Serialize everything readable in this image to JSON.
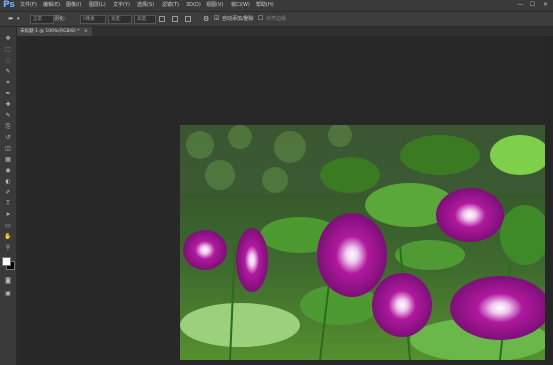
{
  "app": {
    "logo": "Ps"
  },
  "menu": [
    "文件(F)",
    "编辑(E)",
    "图像(I)",
    "图层(L)",
    "文字(Y)",
    "选择(S)",
    "滤镜(T)",
    "3D(D)",
    "视图(V)",
    "窗口(W)",
    "帮助(H)"
  ],
  "window_controls": {
    "minimize": "—",
    "maximize": "☐",
    "close": "✕"
  },
  "options": {
    "feather_label": "羽化:",
    "feather_value": "0像素",
    "style_label": "样式:",
    "style_value": "正常",
    "width_label": "宽度:",
    "height_label": "高度:",
    "auto_add_delete": "自动添加/删除",
    "align_edges": "对齐边缘"
  },
  "document": {
    "tab_title": "未标题-1 @ 100%(RGB/8) *",
    "close": "×"
  },
  "toolbar": {
    "tools": [
      "move-tool",
      "marquee-tool",
      "lasso-tool",
      "quick-select-tool",
      "crop-tool",
      "eyedropper-tool",
      "healing-tool",
      "brush-tool",
      "stamp-tool",
      "history-brush-tool",
      "eraser-tool",
      "gradient-tool",
      "blur-tool",
      "dodge-tool",
      "pen-tool",
      "type-tool",
      "path-select-tool",
      "shape-tool",
      "hand-tool",
      "zoom-tool"
    ],
    "glyphs": [
      "✥",
      "⬚",
      "◌",
      "✎",
      "⌗",
      "✒",
      "✚",
      "✎",
      "⎘",
      "↺",
      "◫",
      "▦",
      "◉",
      "◐",
      "✐",
      "T",
      "➤",
      "▭",
      "✋",
      "⚲"
    ],
    "foreground_color": "#ffffff",
    "background_color": "#000000"
  },
  "canvas": {
    "description": "morning glory flowers photo"
  }
}
